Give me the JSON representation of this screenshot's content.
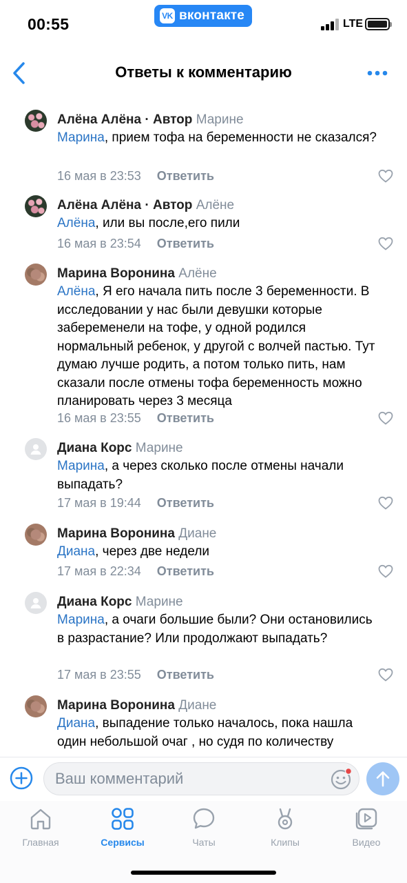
{
  "status_bar": {
    "time": "00:55",
    "carrier_badge": "вконтакте",
    "network": "LTE"
  },
  "header": {
    "title": "Ответы к комментарию"
  },
  "comments": [
    {
      "author": "Алёна Алёна",
      "role": " · Автор",
      "reply_to": "Марине",
      "mention": "Марина",
      "text": ", прием тофа на беременности не сказался?",
      "date": "16 мая в 23:53",
      "answer_label": "Ответить",
      "avatar": "flowers"
    },
    {
      "author": "Алёна Алёна",
      "role": " · Автор",
      "reply_to": "Алёне",
      "mention": "Алёна",
      "text": ", или вы после,его пили",
      "date": "16 мая в 23:54",
      "answer_label": "Ответить",
      "avatar": "flowers"
    },
    {
      "author": "Марина Воронина",
      "role": "",
      "reply_to": "Алёне",
      "mention": "Алёна",
      "text": ", Я его начала пить после 3 беременности. В исследовании у нас были девушки которые забеременели на тофе, у одной родился нормальный ребенок, у другой с волчей пастью. Тут думаю лучше родить, а потом только пить, нам сказали после отмены тофа беременность можно планировать через 3 месяца",
      "date": "16 мая в 23:55",
      "answer_label": "Ответить",
      "avatar": "photo"
    },
    {
      "author": "Диана Корс",
      "role": "",
      "reply_to": "Марине",
      "mention": "Марина",
      "text": ", а через сколько после отмены начали выпадать?",
      "date": "17 мая в 19:44",
      "answer_label": "Ответить",
      "avatar": "default"
    },
    {
      "author": "Марина Воронина",
      "role": "",
      "reply_to": "Диане",
      "mention": "Диана",
      "text": ", через две недели",
      "date": "17 мая в 22:34",
      "answer_label": "Ответить",
      "avatar": "photo"
    },
    {
      "author": "Диана Корс",
      "role": "",
      "reply_to": "Марине",
      "mention": "Марина",
      "text": ", а очаги большие были? Они остановились в разрастание? Или продолжают выпадать?",
      "date": "17 мая в 23:55",
      "answer_label": "Ответить",
      "avatar": "default"
    },
    {
      "author": "Марина Воронина",
      "role": "",
      "reply_to": "Диане",
      "mention": "Диана",
      "text": ", выпадение только началось, пока нашла один небольшой очаг , но судя по количеству",
      "date": "",
      "answer_label": "",
      "avatar": "photo"
    }
  ],
  "composer": {
    "placeholder": "Ваш комментарий"
  },
  "tabbar": {
    "active": "services",
    "items": [
      {
        "id": "home",
        "label": "Главная",
        "icon": "home-icon"
      },
      {
        "id": "services",
        "label": "Сервисы",
        "icon": "services-icon"
      },
      {
        "id": "chats",
        "label": "Чаты",
        "icon": "chat-icon"
      },
      {
        "id": "clips",
        "label": "Клипы",
        "icon": "clips-icon"
      },
      {
        "id": "video",
        "label": "Видео",
        "icon": "video-icon"
      }
    ]
  },
  "colors": {
    "accent": "#2688eb",
    "mention": "#2a74c5",
    "secondary_text": "#818c99",
    "send_button": "#9fc6f5"
  }
}
